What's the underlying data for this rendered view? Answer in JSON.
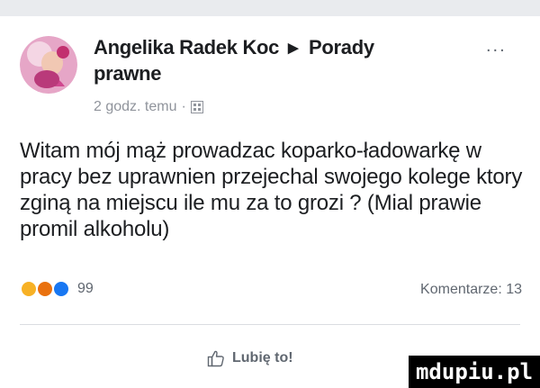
{
  "post": {
    "author": "Angelika Radek Koc",
    "target_line1": "Porady",
    "target_line2": "prawne",
    "timestamp": "2 godz. temu",
    "body": "Witam mój mąż prowadzac koparko-ładowarkę w pracy bez uprawnien przejechal swojego kolege ktory zginą na miejscu ile mu za to grozi ? (Mial prawie promil alkoholu)",
    "reactions": {
      "count": "99",
      "types": [
        "wow-reaction-icon",
        "angry-reaction-icon",
        "like-reaction-icon"
      ],
      "colors": [
        "#f7b125",
        "#e9710f",
        "#1877f2"
      ]
    },
    "comments_label": "Komentarze: 13",
    "like_label": "Lubię to!"
  },
  "icons": {
    "share_arrow": "▶",
    "more": "...",
    "dot": "·"
  },
  "watermark": "mdupiu.pl"
}
